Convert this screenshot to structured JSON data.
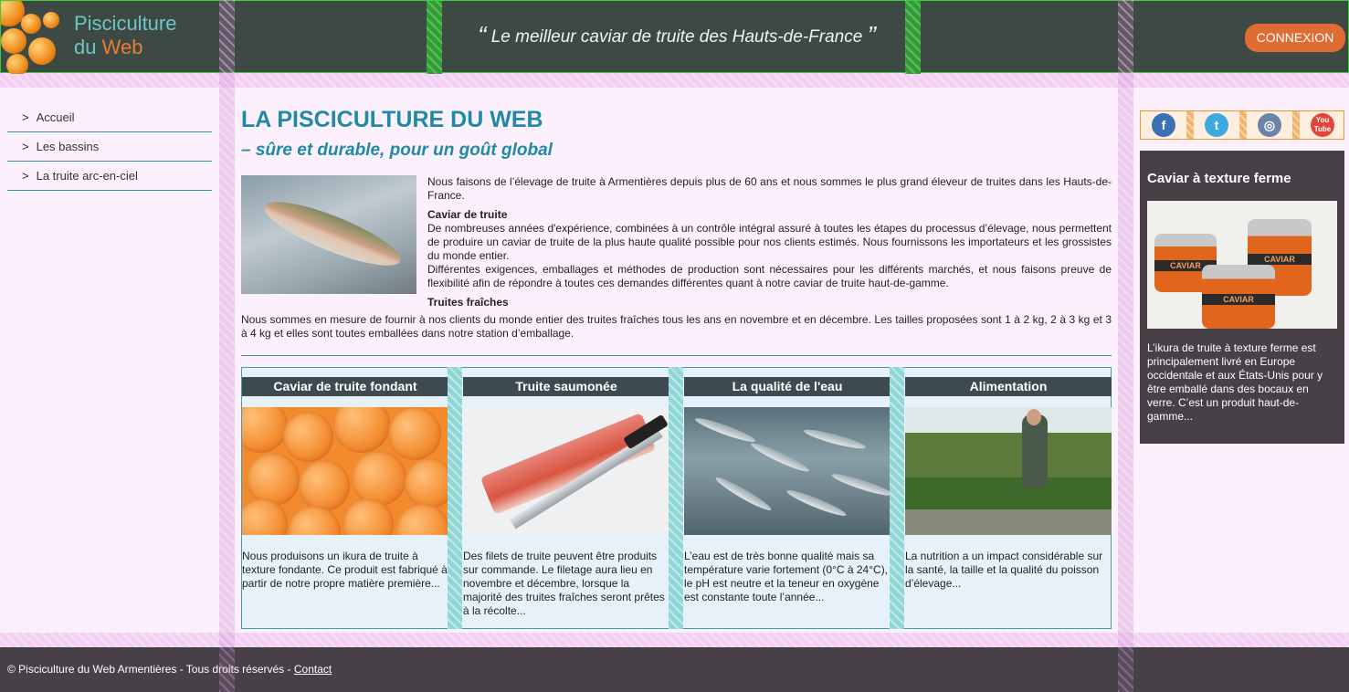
{
  "header": {
    "logo_line1": "Pisciculture",
    "logo_line2a": "du ",
    "logo_line2b": "Web",
    "tagline_open": "“",
    "tagline": "Le meilleur caviar de truite des Hauts-de-France",
    "tagline_close": "”",
    "login_label": "CONNEXION"
  },
  "nav": {
    "items": [
      {
        "arrow": ">",
        "label": "Accueil"
      },
      {
        "arrow": ">",
        "label": "Les bassins"
      },
      {
        "arrow": ">",
        "label": "La truite arc-en-ciel"
      }
    ]
  },
  "main": {
    "title": "LA PISCICULTURE DU WEB",
    "subtitle": "– sûre et durable, pour un goût global",
    "intro": "Nous faisons de l’élevage de truite à Armentières depuis plus de 60 ans et nous sommes le plus grand éleveur de truites dans les Hauts-de-France.",
    "caviar_heading": "Caviar de truite",
    "caviar_p1": "De nombreuses années d'expérience, combinées à un contrôle intégral assuré à toutes les étapes du processus d’élevage, nous permettent de produire un caviar de truite de la plus haute qualité possible pour nos clients estimés. Nous fournissons les importateurs et les grossistes du monde entier.",
    "caviar_p2": "Différentes exigences, emballages et méthodes de production sont nécessaires pour les différents marchés, et nous faisons preuve de flexibilité afin de répondre à toutes ces demandes différentes quant à notre caviar de truite haut-de-gamme.",
    "fresh_heading": "Truites fraîches",
    "fresh_p": "Nous sommes en mesure de fournir à nos clients du monde entier des truites fraîches tous les ans en novembre et en décembre. Les tailles proposées sont 1 à 2 kg, 2 à 3 kg et 3 à 4 kg et elles sont toutes emballées dans notre station d’emballage."
  },
  "cards": [
    {
      "title": "Caviar de truite fondant",
      "text": "Nous produisons un ikura de truite à texture fondante. Ce produit est fabriqué à partir de notre propre matière première..."
    },
    {
      "title": "Truite saumonée",
      "text": "Des filets de truite peuvent être produits sur commande. Le filetage aura lieu en novembre et décembre, lorsque la majorité des truites fraîches seront prêtes à la récolte..."
    },
    {
      "title": "La qualité de l'eau",
      "text": "L’eau est de très bonne qualité mais sa température varie fortement (0°C à 24°C), le pH est neutre et la teneur en oxygène est constante toute l’année..."
    },
    {
      "title": "Alimentation",
      "text": "La nutrition a un impact considérable sur la santé, la taille et la qualité du poisson d’élevage..."
    }
  ],
  "social": {
    "facebook": "f",
    "twitter": "t",
    "instagram": "◎",
    "youtube": "You Tube"
  },
  "promo": {
    "title": "Caviar à texture ferme",
    "jar_label": "CAVIAR",
    "text": "L’ikura de truite à texture ferme est principalement livré en Europe occidentale et aux États-Unis pour y être emballé dans des bocaux en verre. C’est un produit haut-de-gamme..."
  },
  "footer": {
    "copyright": "© Pisciculture du Web Armentières - Tous droits réservés - ",
    "contact_label": "Contact"
  }
}
